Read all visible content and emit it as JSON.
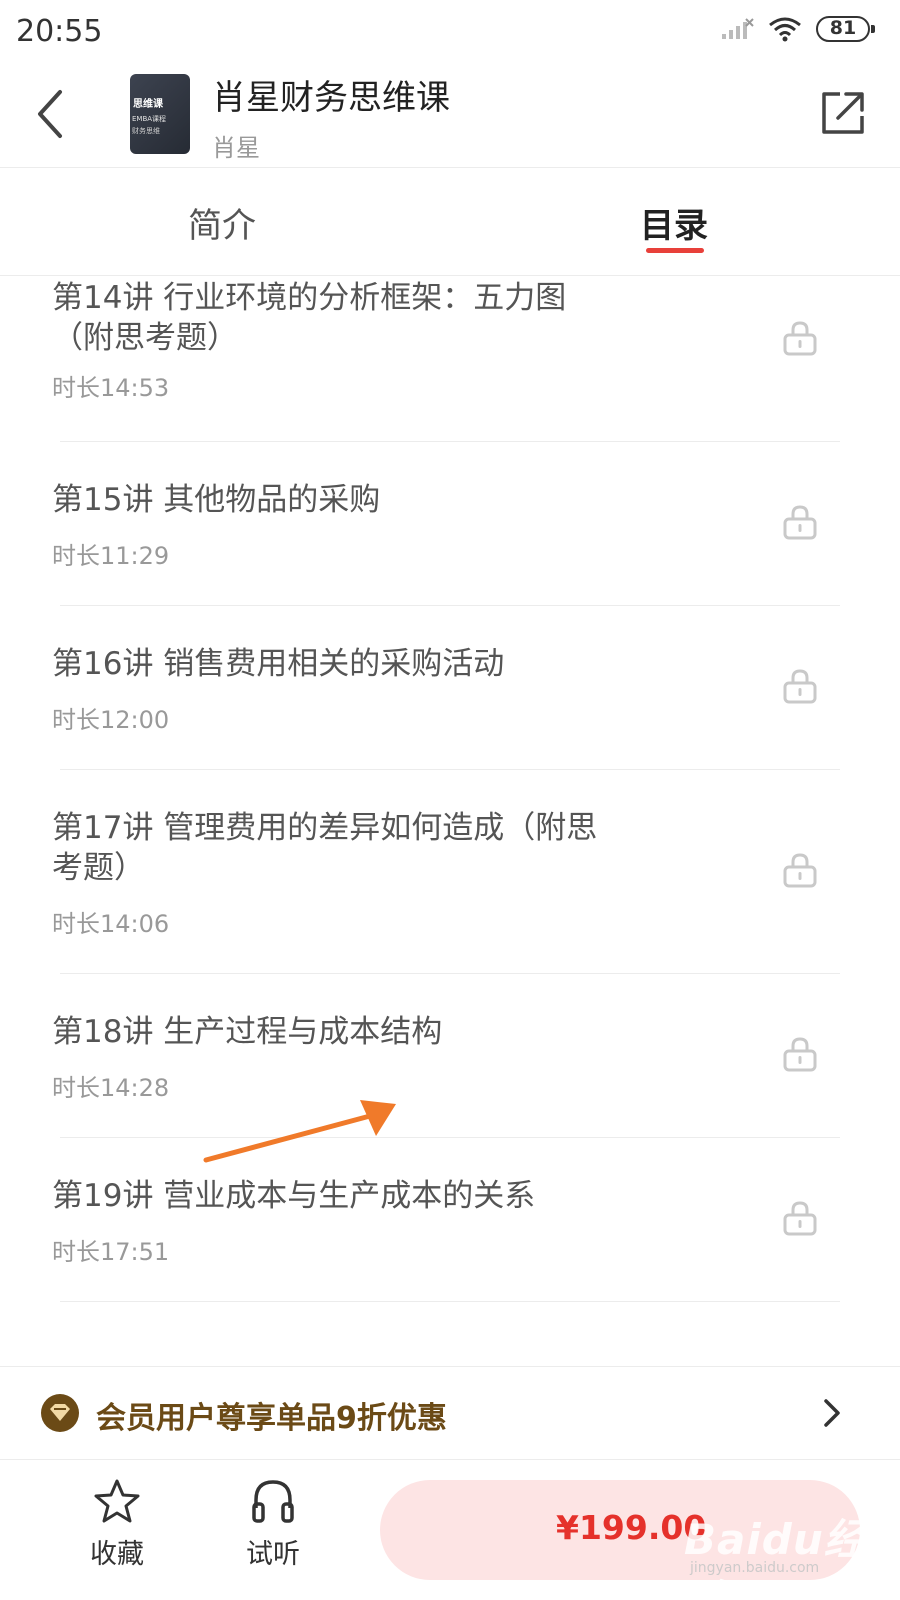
{
  "status_bar": {
    "time": "20:55",
    "battery": "81"
  },
  "header": {
    "title": "肖星财务思维课",
    "author": "肖星",
    "cover": {
      "line1": "思维课",
      "line2": "EMBA课程",
      "line3": "财务思维"
    }
  },
  "tabs": [
    {
      "label": "简介",
      "active": false
    },
    {
      "label": "目录",
      "active": true
    }
  ],
  "lessons": [
    {
      "title": "第14讲 行业环境的分析框架：五力图（附思考题）",
      "duration": "时长14:53",
      "locked": true
    },
    {
      "title": "第15讲 其他物品的采购",
      "duration": "时长11:29",
      "locked": true
    },
    {
      "title": "第16讲 销售费用相关的采购活动",
      "duration": "时长12:00",
      "locked": true
    },
    {
      "title": "第17讲 管理费用的差异如何造成（附思考题）",
      "duration": "时长14:06",
      "locked": true
    },
    {
      "title": "第18讲 生产过程与成本结构",
      "duration": "时长14:28",
      "locked": true
    },
    {
      "title": "第19讲 营业成本与生产成本的关系",
      "duration": "时长17:51",
      "locked": true
    }
  ],
  "promo": {
    "text": "会员用户尊享单品9折优惠"
  },
  "bottom": {
    "favorite_label": "收藏",
    "listen_label": "试听",
    "price": "¥199.00",
    "watermark": "Baidu经验",
    "watermark_sub": "jingyan.baidu.com"
  },
  "colors": {
    "accent": "#e8403a",
    "price": "#e5312b",
    "promo_text": "#6b4a16",
    "buy_bg": "#fde4e4"
  },
  "icons": [
    "back-icon",
    "share-icon",
    "lock-icon",
    "vip-icon",
    "chevron-right-icon",
    "star-icon",
    "headphones-icon"
  ]
}
